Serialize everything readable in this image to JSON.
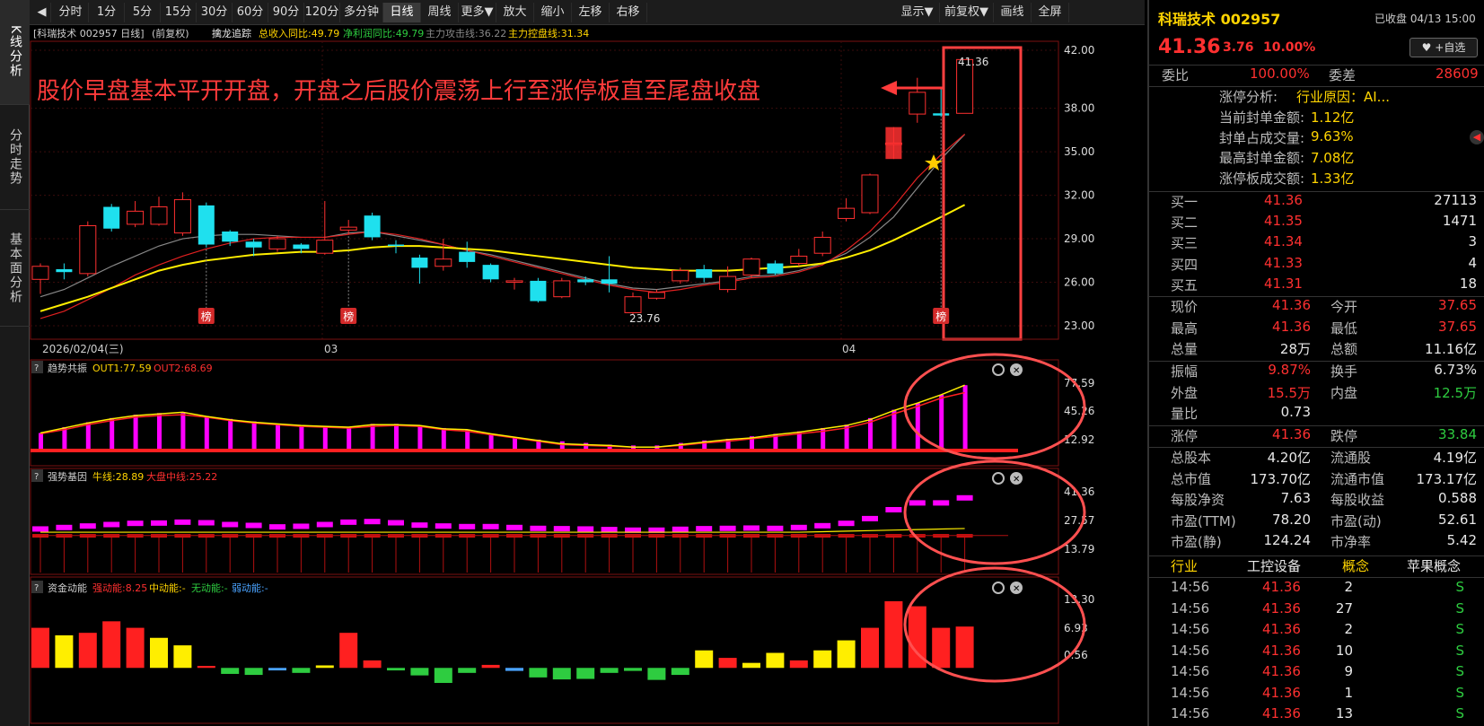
{
  "left_tabs": [
    "K线分析",
    "分时走势",
    "基本面分析"
  ],
  "toolbar": {
    "left": [
      "分时",
      "1分",
      "5分",
      "15分",
      "30分",
      "60分",
      "90分",
      "120分",
      "多分钟",
      "日线",
      "周线",
      "更多▼",
      "放大",
      "缩小",
      "左移",
      "右移"
    ],
    "right": [
      "显示▼",
      "前复权▼",
      "画线",
      "全屏"
    ],
    "active": "日线"
  },
  "chart_header": {
    "stock": "[科瑞技术 002957 日线]",
    "adj": "(前复权)",
    "indicator": "擒龙追踪",
    "m1": "总收入同比:49.79",
    "m2": "净利润同比:49.79",
    "m3": "主力攻击线:36.22",
    "m4": "主力控盘线:31.34"
  },
  "annotation": "股价早盘基本平开开盘，开盘之后股价震荡上行至涨停板直至尾盘收盘",
  "price_labels": {
    "high": "41.36",
    "low": "23.76"
  },
  "list_badge": "榜",
  "y_axis_main": [
    "42.00",
    "38.00",
    "35.00",
    "32.00",
    "29.00",
    "26.00",
    "23.00"
  ],
  "x_axis": [
    "2026/02/04(三)",
    "03",
    "04"
  ],
  "sub1": {
    "title": "趋势共振",
    "l1": "OUT1:77.59",
    "l2": "OUT2:68.69",
    "axis": [
      "77.59",
      "45.26",
      "12.92"
    ]
  },
  "sub2": {
    "title": "强势基因",
    "l1": "牛线:28.89",
    "l2": "大盘中线:25.22",
    "axis": [
      "41.36",
      "27.57",
      "13.79"
    ]
  },
  "sub3": {
    "title": "资金动能",
    "l1": "强动能:8.25",
    "l2": "中动能:-",
    "l3": "无动能:-",
    "l4": "弱动能:-",
    "axis": [
      "13.30",
      "6.93",
      "0.56"
    ]
  },
  "chart_data": [
    {
      "type": "candlestick",
      "title": "科瑞技术 002957 日线",
      "ylim": [
        23.0,
        42.0
      ],
      "candles": [
        [
          26.2,
          27.1,
          25.2,
          27.3
        ],
        [
          26.9,
          26.7,
          26.2,
          27.3
        ],
        [
          26.6,
          29.9,
          26.4,
          30.2
        ],
        [
          31.2,
          29.7,
          29.5,
          31.4
        ],
        [
          30.0,
          30.9,
          29.8,
          31.6
        ],
        [
          30.0,
          31.2,
          29.9,
          31.9
        ],
        [
          29.4,
          31.7,
          29.2,
          32.2
        ],
        [
          31.3,
          28.6,
          28.4,
          31.5
        ],
        [
          29.5,
          28.8,
          28.5,
          29.6
        ],
        [
          28.8,
          28.4,
          27.8,
          29.0
        ],
        [
          28.3,
          29.0,
          28.1,
          29.2
        ],
        [
          28.6,
          28.3,
          28.0,
          28.7
        ],
        [
          28.0,
          28.9,
          27.9,
          31.6
        ],
        [
          29.6,
          29.8,
          29.3,
          30.3
        ],
        [
          30.6,
          29.1,
          28.9,
          30.8
        ],
        [
          28.6,
          28.5,
          28.0,
          28.9
        ],
        [
          27.7,
          27.0,
          25.9,
          27.9
        ],
        [
          27.1,
          27.6,
          26.8,
          29.0
        ],
        [
          28.1,
          27.4,
          27.0,
          28.8
        ],
        [
          27.2,
          26.2,
          26.0,
          27.3
        ],
        [
          26.0,
          26.1,
          25.5,
          26.3
        ],
        [
          26.1,
          24.7,
          24.6,
          26.3
        ],
        [
          25.0,
          26.1,
          24.9,
          26.3
        ],
        [
          26.2,
          26.0,
          25.8,
          26.4
        ],
        [
          26.2,
          25.9,
          25.3,
          27.8
        ],
        [
          23.9,
          25.0,
          23.76,
          25.3
        ],
        [
          24.9,
          25.3,
          24.8,
          25.5
        ],
        [
          26.1,
          26.8,
          25.9,
          27.0
        ],
        [
          26.9,
          26.3,
          26.0,
          27.2
        ],
        [
          25.5,
          26.4,
          25.3,
          27.1
        ],
        [
          26.5,
          27.6,
          26.3,
          27.7
        ],
        [
          27.3,
          26.6,
          26.5,
          27.5
        ],
        [
          27.3,
          27.8,
          27.1,
          28.3
        ],
        [
          28.0,
          29.1,
          27.8,
          29.5
        ],
        [
          30.4,
          31.1,
          30.2,
          31.8
        ],
        [
          30.8,
          33.4,
          30.7,
          33.5
        ],
        [
          35.5,
          35.6,
          34.5,
          36.7
        ],
        [
          37.6,
          39.1,
          37.0,
          40.1
        ],
        [
          37.65,
          37.5,
          37.4,
          39.4
        ],
        [
          37.65,
          41.36,
          37.65,
          41.36
        ]
      ],
      "ma_gray": [
        25.0,
        25.5,
        26.3,
        27.1,
        27.8,
        28.5,
        29.0,
        29.2,
        29.3,
        29.3,
        29.2,
        29.1,
        29.1,
        29.4,
        29.5,
        29.2,
        28.9,
        28.6,
        28.2,
        27.9,
        27.5,
        27.1,
        26.7,
        26.3,
        25.9,
        25.6,
        25.5,
        25.7,
        25.9,
        26.1,
        26.4,
        26.5,
        26.8,
        27.3,
        28.0,
        29.1,
        30.5,
        32.5,
        34.5,
        36.2
      ],
      "ma_yellow": [
        24.0,
        24.5,
        25.0,
        25.6,
        26.2,
        26.8,
        27.2,
        27.5,
        27.7,
        27.9,
        28.0,
        28.1,
        28.1,
        28.2,
        28.4,
        28.5,
        28.5,
        28.4,
        28.3,
        28.2,
        28.0,
        27.8,
        27.6,
        27.4,
        27.2,
        27.0,
        26.9,
        26.8,
        26.8,
        26.8,
        26.9,
        27.0,
        27.1,
        27.3,
        27.7,
        28.2,
        28.9,
        29.7,
        30.5,
        31.34
      ],
      "ma_red": [
        23.5,
        24.0,
        24.8,
        25.6,
        26.5,
        27.2,
        27.8,
        28.3,
        28.7,
        29.0,
        29.1,
        29.1,
        29.1,
        29.3,
        29.5,
        29.3,
        29.0,
        28.6,
        28.2,
        27.8,
        27.4,
        27.0,
        26.6,
        26.2,
        25.8,
        25.5,
        25.3,
        25.5,
        25.8,
        26.0,
        26.3,
        26.4,
        26.7,
        27.2,
        28.2,
        29.5,
        31.2,
        33.2,
        34.8,
        36.22
      ]
    },
    {
      "type": "bar",
      "title": "趋势共振",
      "ylim": [
        0,
        80
      ],
      "values": [
        20,
        27,
        33,
        38,
        42,
        44,
        44,
        40,
        37,
        34,
        31,
        29,
        28,
        27,
        31,
        31,
        29,
        26,
        24,
        19,
        15,
        12,
        10,
        8,
        6,
        5,
        5,
        8,
        11,
        13,
        16,
        19,
        22,
        26,
        30,
        38,
        48,
        56,
        66,
        77.59
      ],
      "out1": [
        20,
        26,
        32,
        37,
        41,
        43,
        45,
        40,
        36,
        33,
        31,
        29,
        28,
        27,
        30,
        30,
        29,
        25,
        24,
        19,
        15,
        11,
        7,
        6,
        5,
        3,
        3,
        6,
        9,
        12,
        14,
        18,
        21,
        25,
        29,
        36,
        47,
        56,
        66,
        77.59
      ],
      "out2": [
        19,
        24,
        30,
        35,
        39,
        41,
        42,
        39,
        35,
        32,
        30,
        28,
        27,
        26,
        28,
        29,
        28,
        24,
        22,
        18,
        14,
        10,
        6,
        5,
        4,
        3,
        3,
        5,
        8,
        10,
        13,
        16,
        19,
        22,
        26,
        33,
        43,
        52,
        62,
        68.69
      ]
    },
    {
      "type": "bar",
      "title": "强势基因",
      "ylim": [
        13.79,
        41.36
      ],
      "values": [
        28.5,
        29,
        29.5,
        30,
        30.4,
        30.5,
        30.8,
        30.6,
        30,
        29.7,
        29.2,
        29.4,
        30.0,
        30.8,
        31.0,
        30.6,
        29.8,
        29.5,
        29.3,
        29.3,
        29.0,
        28.7,
        28.6,
        28.5,
        28.3,
        28.1,
        28.1,
        28.4,
        28.6,
        28.7,
        28.8,
        28.7,
        29.0,
        29.6,
        30.4,
        32.0,
        35.0,
        37.3,
        37.3,
        39.0
      ],
      "niu": [
        28.89
      ],
      "dapan": [
        25.22
      ]
    },
    {
      "type": "bar",
      "title": "资金动能",
      "ylim": [
        -3,
        13.3
      ],
      "values": [
        8,
        6.5,
        7,
        9.3,
        8.0,
        6.0,
        4.5,
        0.4,
        -1.2,
        -1.4,
        -0.5,
        -1,
        0.5,
        7,
        1.5,
        -0.5,
        -1.5,
        -3,
        -1.0,
        0.6,
        -0.6,
        -1.9,
        -2.3,
        -2.2,
        -1.0,
        -0.6,
        -2.4,
        -1.4,
        3.5,
        2.0,
        1.0,
        3.0,
        1.5,
        3.5,
        5.5,
        8,
        13.3,
        12.3,
        8.0,
        8.25
      ]
    }
  ],
  "rp": {
    "title": "科瑞技术 002957",
    "status": "已收盘 04/13 15:00",
    "price": "41.36",
    "chg": "3.76",
    "pct": "10.00%",
    "fav": "+自选",
    "wb_label": "委比",
    "wb": "100.00%",
    "wc_label": "委差",
    "wc": "28609",
    "zt_title": "涨停分析:",
    "zt_reason": "行业原因：AI...",
    "zt": [
      {
        "k": "当前封单金额:",
        "v": "1.12亿"
      },
      {
        "k": "封单占成交量:",
        "v": "9.63%"
      },
      {
        "k": "最高封单金额:",
        "v": "7.08亿"
      },
      {
        "k": "涨停板成交额:",
        "v": "1.33亿"
      }
    ],
    "buy": [
      {
        "k": "买一",
        "p": "41.36",
        "v": "27113"
      },
      {
        "k": "买二",
        "p": "41.35",
        "v": "1471"
      },
      {
        "k": "买三",
        "p": "41.34",
        "v": "3"
      },
      {
        "k": "买四",
        "p": "41.33",
        "v": "4"
      },
      {
        "k": "买五",
        "p": "41.31",
        "v": "18"
      }
    ],
    "q1": [
      {
        "k1": "现价",
        "v1": "41.36",
        "k2": "今开",
        "v2": "37.65"
      },
      {
        "k1": "最高",
        "v1": "41.36",
        "k2": "最低",
        "v2": "37.65"
      },
      {
        "k1": "总量",
        "v1": "28万",
        "k2": "总额",
        "v2": "11.16亿"
      }
    ],
    "q2": [
      {
        "k1": "振幅",
        "v1": "9.87%",
        "k2": "换手",
        "v2": "6.73%"
      },
      {
        "k1": "外盘",
        "v1": "15.5万",
        "k2": "内盘",
        "v2": "12.5万"
      },
      {
        "k1": "量比",
        "v1": "0.73",
        "k2": "",
        "v2": ""
      }
    ],
    "q3": [
      {
        "k1": "涨停",
        "v1": "41.36",
        "k2": "跌停",
        "v2": "33.84"
      }
    ],
    "fund": [
      {
        "k1": "总股本",
        "v1": "4.20亿",
        "k2": "流通股",
        "v2": "4.19亿"
      },
      {
        "k1": "总市值",
        "v1": "173.70亿",
        "k2": "流通市值",
        "v2": "173.17亿"
      },
      {
        "k1": "每股净资",
        "v1": "7.63",
        "k2": "每股收益",
        "v2": "0.588"
      },
      {
        "k1": "市盈(TTM)",
        "v1": "78.20",
        "k2": "市盈(动)",
        "v2": "52.61"
      },
      {
        "k1": "市盈(静)",
        "v1": "124.24",
        "k2": "市净率",
        "v2": "5.42"
      }
    ],
    "industry_label": "行业",
    "industry": "工控设备",
    "concept_label": "概念",
    "concept": "苹果概念",
    "ticks": [
      {
        "t": "14:56",
        "p": "41.36",
        "v": "2",
        "s": "S"
      },
      {
        "t": "14:56",
        "p": "41.36",
        "v": "27",
        "s": "S"
      },
      {
        "t": "14:56",
        "p": "41.36",
        "v": "2",
        "s": "S"
      },
      {
        "t": "14:56",
        "p": "41.36",
        "v": "10",
        "s": "S"
      },
      {
        "t": "14:56",
        "p": "41.36",
        "v": "9",
        "s": "S"
      },
      {
        "t": "14:56",
        "p": "41.36",
        "v": "1",
        "s": "S"
      },
      {
        "t": "14:56",
        "p": "41.36",
        "v": "13",
        "s": "S"
      }
    ]
  }
}
